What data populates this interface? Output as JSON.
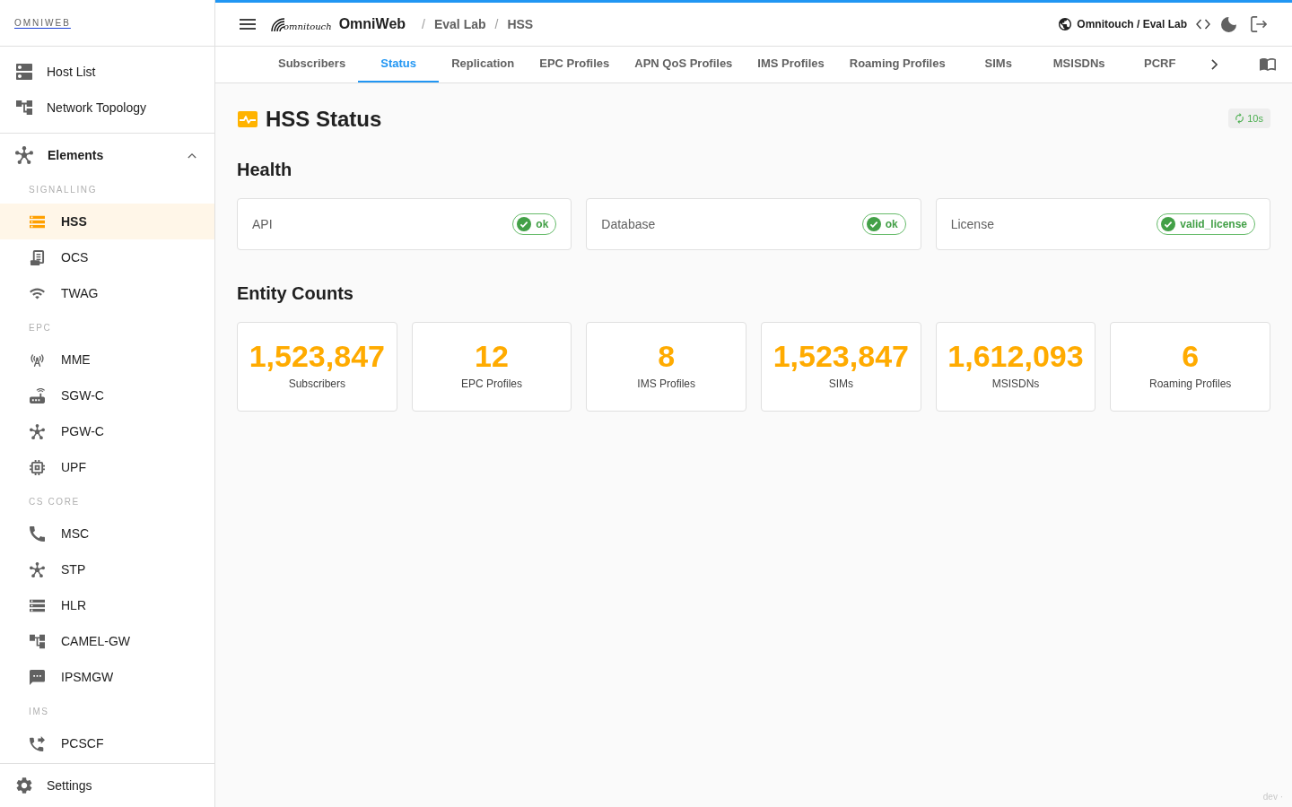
{
  "sidebar": {
    "brand": "OMNIWEB",
    "items": [
      {
        "label": "Host List"
      },
      {
        "label": "Network Topology"
      }
    ],
    "group": {
      "label": "Elements",
      "expanded": true,
      "sections": [
        {
          "label": "SIGNALLING",
          "items": [
            {
              "label": "HSS",
              "selected": true
            },
            {
              "label": "OCS",
              "selected": false
            },
            {
              "label": "TWAG",
              "selected": false
            }
          ]
        },
        {
          "label": "EPC",
          "items": [
            {
              "label": "MME",
              "selected": false
            },
            {
              "label": "SGW-C",
              "selected": false
            },
            {
              "label": "PGW-C",
              "selected": false
            },
            {
              "label": "UPF",
              "selected": false
            }
          ]
        },
        {
          "label": "CS CORE",
          "items": [
            {
              "label": "MSC",
              "selected": false
            },
            {
              "label": "STP",
              "selected": false
            },
            {
              "label": "HLR",
              "selected": false
            },
            {
              "label": "CAMEL-GW",
              "selected": false
            },
            {
              "label": "IPSMGW",
              "selected": false
            }
          ]
        },
        {
          "label": "IMS",
          "items": [
            {
              "label": "PCSCF",
              "selected": false
            }
          ]
        }
      ]
    },
    "footer_items": [
      {
        "label": "Settings"
      }
    ]
  },
  "header": {
    "logo_text": "omnitouch",
    "app_name": "OmniWeb",
    "breadcrumbs": [
      {
        "separator": "/",
        "label": "Eval Lab"
      },
      {
        "separator": "/",
        "label": "HSS"
      }
    ],
    "tenant": "Omnitouch / Eval Lab"
  },
  "tabs": [
    {
      "label": "Subscribers",
      "selected": false
    },
    {
      "label": "Status",
      "selected": true
    },
    {
      "label": "Replication",
      "selected": false
    },
    {
      "label": "EPC Profiles",
      "selected": false
    },
    {
      "label": "APN QoS Profiles",
      "selected": false
    },
    {
      "label": "IMS Profiles",
      "selected": false
    },
    {
      "label": "Roaming Profiles",
      "selected": false
    },
    {
      "label": "SIMs",
      "selected": false
    },
    {
      "label": "MSISDNs",
      "selected": false
    },
    {
      "label": "PCRF",
      "selected": false
    }
  ],
  "status_page": {
    "title": "HSS Status",
    "refresh_interval": "10s",
    "health_heading": "Health",
    "health": [
      {
        "label": "API",
        "status": "ok",
        "ok": true
      },
      {
        "label": "Database",
        "status": "ok",
        "ok": true
      },
      {
        "label": "License",
        "status": "valid_license",
        "ok": true
      }
    ],
    "counts_heading": "Entity Counts",
    "counts": [
      {
        "value": "1,523,847",
        "label": "Subscribers"
      },
      {
        "value": "12",
        "label": "EPC Profiles"
      },
      {
        "value": "8",
        "label": "IMS Profiles"
      },
      {
        "value": "1,523,847",
        "label": "SIMs"
      },
      {
        "value": "1,612,093",
        "label": "MSISDNs"
      },
      {
        "value": "6",
        "label": "Roaming Profiles"
      }
    ]
  },
  "build_label": "dev ·"
}
